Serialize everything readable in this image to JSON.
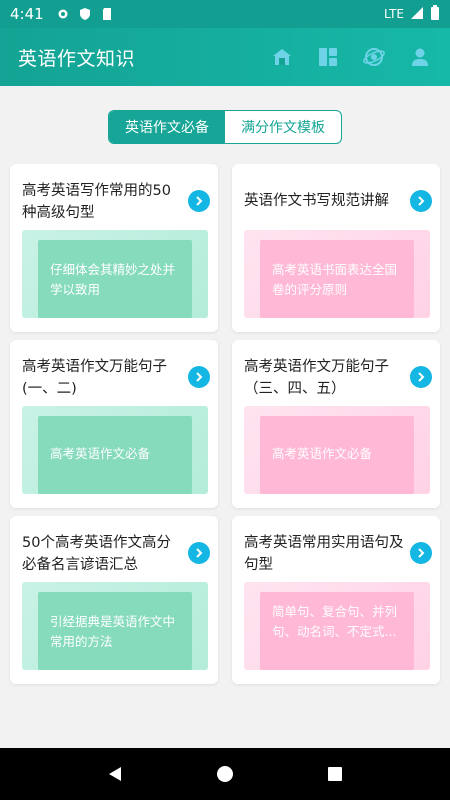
{
  "status": {
    "time": "4:41",
    "network": "LTE"
  },
  "appbar": {
    "title": "英语作文知识",
    "actions": [
      "home-icon",
      "dashboard-icon",
      "explore-icon",
      "profile-icon"
    ]
  },
  "tabs": [
    {
      "label": "英语作文必备",
      "active": true
    },
    {
      "label": "满分作文模板",
      "active": false
    }
  ],
  "cards": [
    {
      "title": "高考英语写作常用的50种高级句型",
      "thumb_text": "仔细体会其精妙之处并学以致用",
      "theme": "green"
    },
    {
      "title": "英语作文书写规范讲解",
      "thumb_text": "高考英语书面表达全国卷的评分原则",
      "theme": "pink"
    },
    {
      "title": "高考英语作文万能句子(一、二)",
      "thumb_text": "高考英语作文必备",
      "theme": "green"
    },
    {
      "title": "高考英语作文万能句子（三、四、五）",
      "thumb_text": "高考英语作文必备",
      "theme": "pink"
    },
    {
      "title": "50个高考英语作文高分必备名言谚语汇总",
      "thumb_text": "引经据典是英语作文中常用的方法",
      "theme": "green"
    },
    {
      "title": "高考英语常用实用语句及句型",
      "thumb_text": "简单句、复合句、并列句、动名词、不定式...",
      "theme": "pink"
    }
  ],
  "colors": {
    "primary": "#16a596",
    "arrow": "#14b6e4",
    "green": "#86dbbd",
    "pink": "#ffb8d5"
  }
}
